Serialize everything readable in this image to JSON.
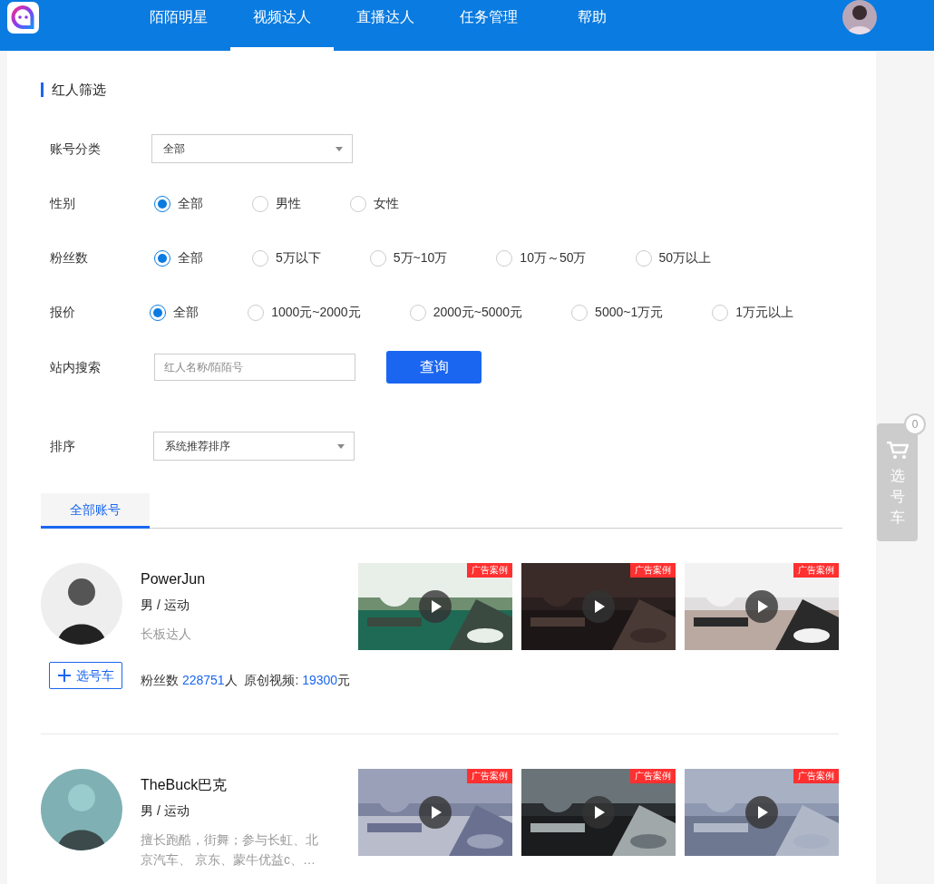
{
  "nav": {
    "items": [
      {
        "label": "陌陌明星",
        "selected": false
      },
      {
        "label": "视频达人",
        "selected": true
      },
      {
        "label": "直播达人",
        "selected": false
      },
      {
        "label": "任务管理",
        "selected": false
      },
      {
        "label": "帮助",
        "selected": false
      }
    ]
  },
  "filter": {
    "title": "红人筛选",
    "category": {
      "label": "账号分类",
      "value": "全部"
    },
    "radio_groups": [
      {
        "label": "性别",
        "options": [
          {
            "label": "全部",
            "selected": true
          },
          {
            "label": "男性",
            "selected": false
          },
          {
            "label": "女性",
            "selected": false
          }
        ]
      },
      {
        "label": "粉丝数",
        "options": [
          {
            "label": "全部",
            "selected": true
          },
          {
            "label": "5万以下",
            "selected": false
          },
          {
            "label": "5万~10万",
            "selected": false
          },
          {
            "label": "10万～50万",
            "selected": false
          },
          {
            "label": "50万以上",
            "selected": false
          }
        ]
      },
      {
        "label": "报价",
        "options": [
          {
            "label": "全部",
            "selected": true
          },
          {
            "label": "1000元~2000元",
            "selected": false
          },
          {
            "label": "2000元~5000元",
            "selected": false
          },
          {
            "label": "5000~1万元",
            "selected": false
          },
          {
            "label": "1万元以上",
            "selected": false
          }
        ]
      }
    ],
    "search": {
      "label": "站内搜索",
      "placeholder": "红人名称/陌陌号",
      "button": "查询"
    },
    "sort": {
      "label": "排序",
      "value": "系统推荐排序"
    }
  },
  "tabs": [
    {
      "label": "全部账号",
      "selected": true
    }
  ],
  "influencers": [
    {
      "name": "PowerJun",
      "tags": "男 / 运动",
      "description": "长板达人",
      "add_button": "选号车",
      "fans_label": "粉丝数",
      "fans": "228751",
      "fans_unit": "人",
      "price_label": "原创视频:",
      "price": "19300",
      "price_unit": "元",
      "videos": [
        {
          "badge": "广告案例"
        },
        {
          "badge": "广告案例"
        },
        {
          "badge": "广告案例"
        }
      ]
    },
    {
      "name": "TheBuck巴克",
      "tags": "男 / 运动",
      "description": "擅长跑酷，街舞；参与长虹、北京汽车、 京东、蒙牛优益c、…",
      "videos": [
        {
          "badge": "广告案例"
        },
        {
          "badge": "广告案例"
        },
        {
          "badge": "广告案例"
        }
      ]
    }
  ],
  "cart": {
    "count": "0",
    "label": "选号车"
  }
}
